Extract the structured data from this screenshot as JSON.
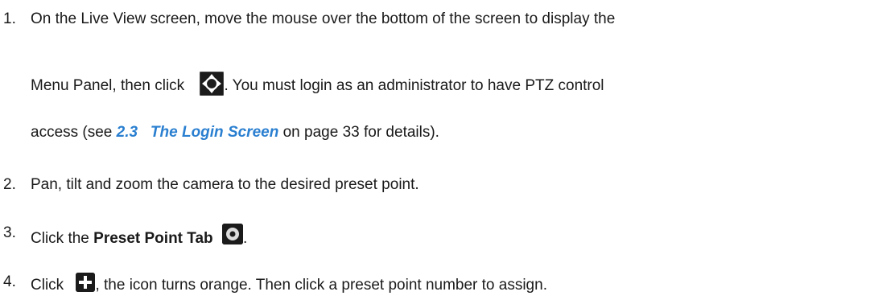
{
  "steps": [
    {
      "number": "1.",
      "line1": "On the Live View screen, move the mouse over the bottom of the screen to display the",
      "line2_before": "Menu Panel, then click",
      "line2_icon": "ptz-move-icon",
      "line2_after": ". You must login as an administrator to have PTZ control",
      "line3_before": "access (see ",
      "line3_link": "2.3   The Login Screen",
      "line3_after": " on page 33 for details)."
    },
    {
      "number": "2.",
      "text": "Pan, tilt and zoom the camera to the desired preset point."
    },
    {
      "number": "3.",
      "text_before": "Click the ",
      "text_bold": "Preset Point Tab",
      "icon": "preset-point-icon",
      "text_after": "."
    },
    {
      "number": "4.",
      "text_before": "Click",
      "icon": "plus-icon",
      "text_after": ", the icon turns orange. Then click a preset point number to assign."
    }
  ],
  "colors": {
    "text": "#1a1a1a",
    "link": "#2a7fd0",
    "icon_bg": "#1b1b1b"
  }
}
